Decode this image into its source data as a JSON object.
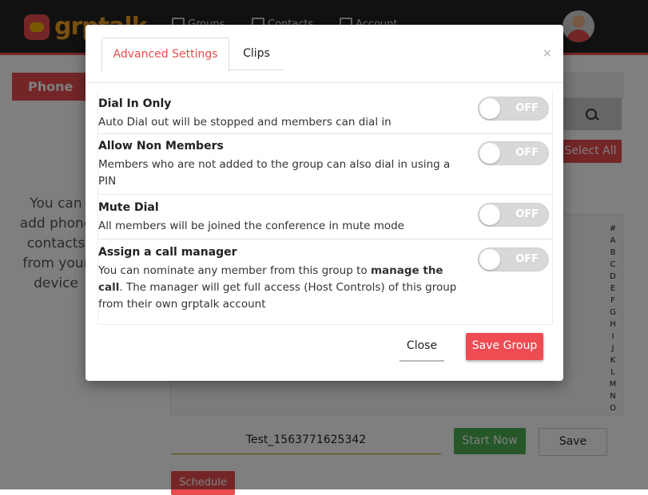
{
  "app": {
    "logo_text": "grptalk"
  },
  "nav": [
    {
      "label": "Groups",
      "icon": "groups-icon"
    },
    {
      "label": "Contacts",
      "icon": "contacts-icon"
    },
    {
      "label": "Account",
      "icon": "account-icon"
    }
  ],
  "background": {
    "tab_label": "Phone Contacts",
    "info_text": "You can add phone contacts from your device",
    "select_all": "Select All",
    "alphabet": [
      "#",
      "A",
      "B",
      "C",
      "D",
      "E",
      "F",
      "G",
      "H",
      "I",
      "J",
      "K",
      "L",
      "M",
      "N",
      "O"
    ],
    "group_name_value": "Test_1563771625342",
    "start_now": "Start Now",
    "save": "Save",
    "schedule": "Schedule"
  },
  "modal": {
    "tabs": [
      {
        "label": "Advanced Settings",
        "active": true
      },
      {
        "label": "Clips",
        "active": false
      }
    ],
    "close_symbol": "×",
    "settings": [
      {
        "title": "Dial In Only",
        "desc_before": "Auto Dial out will be stopped and members can dial in",
        "desc_bold": "",
        "desc_after": "",
        "state": "OFF"
      },
      {
        "title": "Allow Non Members",
        "desc_before": "Members who are not added to the group can also dial in using a PIN",
        "desc_bold": "",
        "desc_after": "",
        "state": "OFF"
      },
      {
        "title": "Mute Dial",
        "desc_before": "All members will be joined the conference in mute mode",
        "desc_bold": "",
        "desc_after": "",
        "state": "OFF"
      },
      {
        "title": "Assign a call manager",
        "desc_before": "You can nominate any member from this group to ",
        "desc_bold": "manage the call",
        "desc_after": ". The manager will get full access (Host Controls) of this group from their own grptalk account",
        "state": "OFF"
      }
    ],
    "close_button": "Close",
    "save_group_button": "Save Group"
  },
  "colors": {
    "accent": "#e84c4f",
    "save_group": "#ef4b53",
    "start_now": "#4caf50"
  }
}
